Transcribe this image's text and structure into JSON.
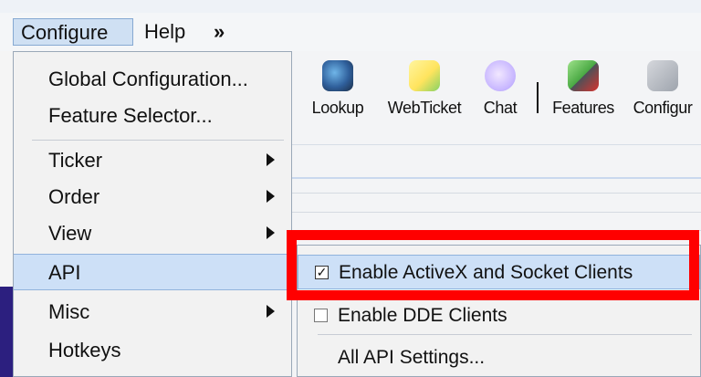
{
  "menubar": {
    "configure": "Configure",
    "help": "Help",
    "overflow": "»"
  },
  "toolbar": {
    "items": [
      {
        "label": "Lookup",
        "icon": "lookup-icon"
      },
      {
        "label": "WebTicket",
        "icon": "webticket-icon"
      },
      {
        "label": "Chat",
        "icon": "chat-icon"
      },
      {
        "label": "Features",
        "icon": "features-icon"
      },
      {
        "label": "Configur",
        "icon": "configure-icon"
      }
    ]
  },
  "dropdown": {
    "items": [
      {
        "label": "Global Configuration..."
      },
      {
        "label": "Feature Selector..."
      },
      {
        "label": "Ticker"
      },
      {
        "label": "Order"
      },
      {
        "label": "View"
      },
      {
        "label": "API"
      },
      {
        "label": "Misc"
      },
      {
        "label": "Hotkeys"
      }
    ]
  },
  "submenu": {
    "items": [
      {
        "label": "Enable ActiveX and Socket Clients",
        "checked": true
      },
      {
        "label": "Enable DDE Clients",
        "checked": false
      },
      {
        "label": "All API Settings..."
      }
    ]
  },
  "colors": {
    "highlight": "#cde0f7",
    "menu_highlight": "#cfe0f3",
    "red_box": "#ff0000",
    "left_purple": "#2c1f7f"
  }
}
